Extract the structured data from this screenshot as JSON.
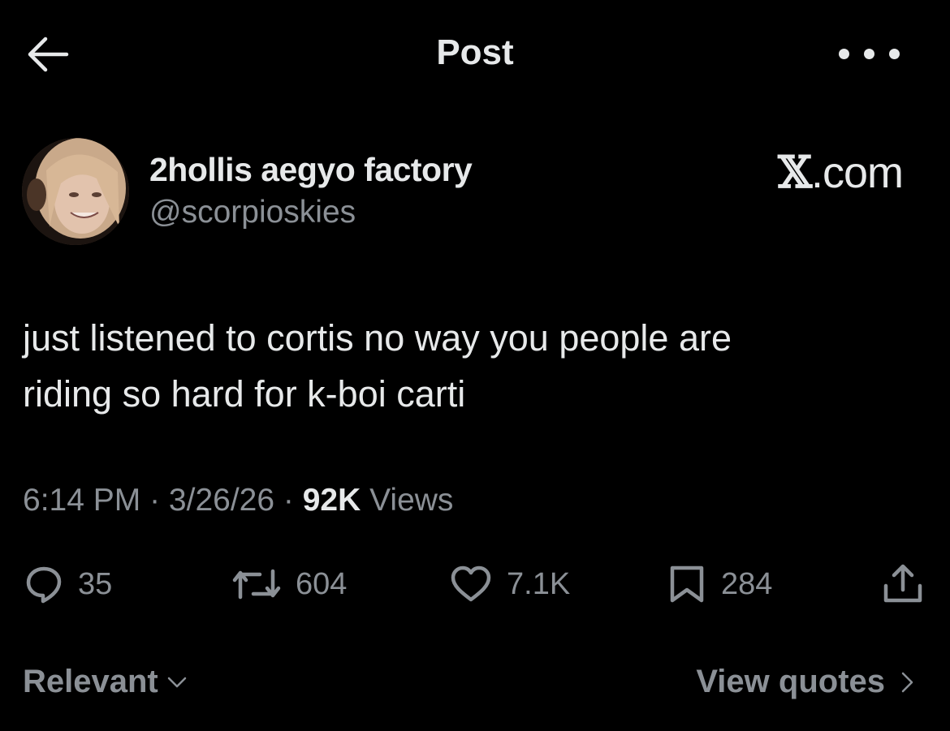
{
  "header": {
    "title": "Post",
    "back_icon": "arrow-left-icon",
    "more_icon": "more-horizontal-icon"
  },
  "author": {
    "display_name": "2hollis aegyo factory",
    "username": "@scorpioskies",
    "avatar_icon": "avatar"
  },
  "watermark": {
    "glyph": "𝕏",
    "text": ".com"
  },
  "tweet": {
    "line1": "just listened to cortis no way you people are",
    "line2": "riding so hard for k-boi carti"
  },
  "meta": {
    "time": "6:14 PM",
    "sep1": " · ",
    "date": "3/26/26",
    "sep2": " · ",
    "views_count": "92K",
    "views_label": " Views"
  },
  "actions": {
    "replies": "35",
    "reposts": "604",
    "likes": "7.1K",
    "bookmarks": "284"
  },
  "footer": {
    "sort_label": "Relevant",
    "view_quotes_label": "View quotes"
  },
  "colors": {
    "background": "#000000",
    "primary_text": "#e7e9ea",
    "secondary_text": "#8b9096"
  }
}
